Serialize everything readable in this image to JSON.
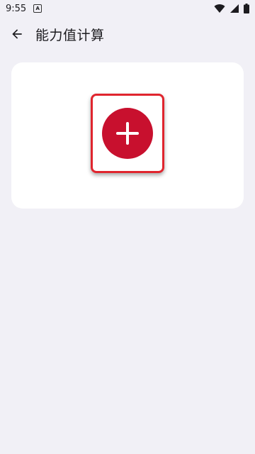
{
  "status_bar": {
    "time": "9:55",
    "notification_icon": "A",
    "icons": [
      "wifi-icon",
      "signal-icon",
      "battery-icon"
    ]
  },
  "header": {
    "back_icon": "arrow-back-icon",
    "title": "能力值计算"
  },
  "card": {
    "add_icon": "add-icon"
  },
  "colors": {
    "background": "#f1f0f6",
    "card": "#ffffff",
    "accent": "#c8102e",
    "highlight_border": "#e0252e"
  }
}
